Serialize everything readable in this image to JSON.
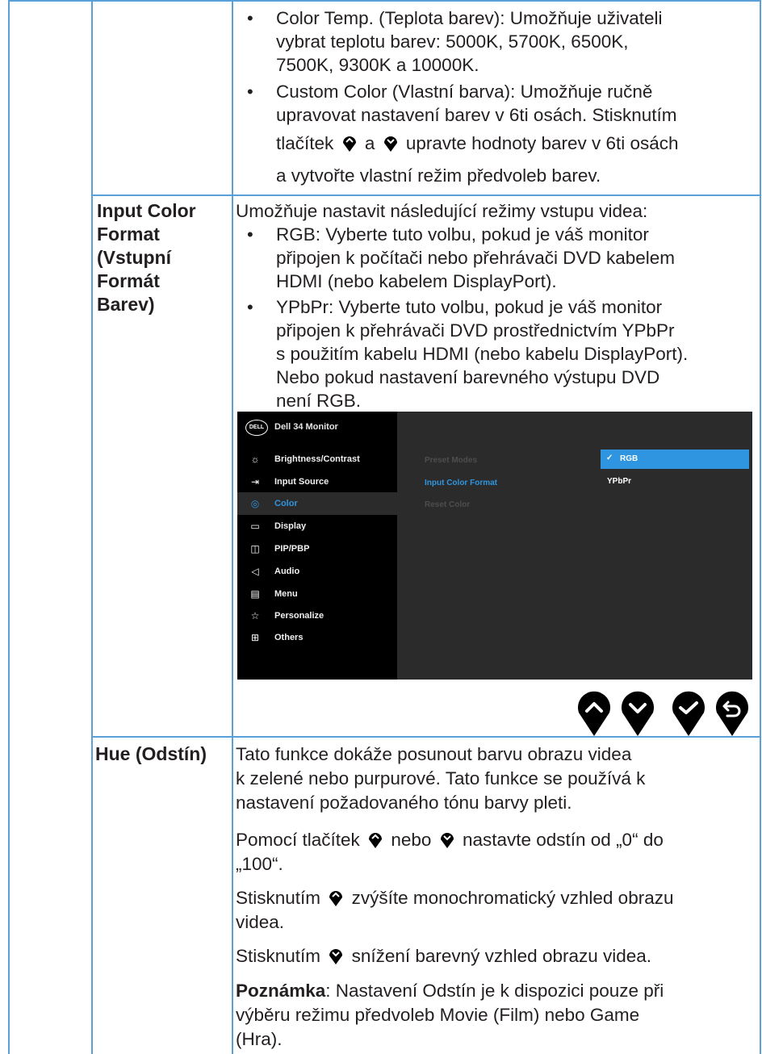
{
  "color_section": {
    "bullets": [
      {
        "lines": [
          "Color Temp. (Teplota barev): Umožňuje uživateli",
          "vybrat teplotu barev: 5000K, 5700K, 6500K,",
          "7500K, 9300K a 10000K."
        ]
      },
      {
        "lines": [
          "Custom Color (Vlastní barva): Umožňuje ručně",
          "upravovat nastavení barev v 6ti osách. Stisknutím"
        ]
      }
    ],
    "custom_line3_a": "tlačítek",
    "custom_line3_b": "a",
    "custom_line3_c": "upravte hodnoty barev v 6ti osách",
    "custom_line4": "a vytvořte vlastní režim předvoleb barev."
  },
  "input_color_format": {
    "label_lines": [
      "Input Color",
      "Format",
      "(Vstupní",
      "Formát",
      "Barev)"
    ],
    "intro": "Umožňuje nastavit následující režimy vstupu videa:",
    "rgb_lines": [
      "RGB: Vyberte tuto volbu, pokud je váš monitor",
      "připojen k počítači nebo přehrávači DVD kabelem",
      "HDMI (nebo kabelem DisplayPort)."
    ],
    "ypbpr_lines": [
      "YPbPr: Vyberte tuto volbu, pokud je váš monitor",
      "připojen k přehrávači DVD prostřednictvím YPbPr",
      "s použitím kabelu HDMI (nebo kabelu DisplayPort).",
      "Nebo pokud nastavení barevného výstupu DVD",
      "není RGB."
    ]
  },
  "osd": {
    "logo": "DELL",
    "title": "Dell 34 Monitor",
    "menu": [
      {
        "label": "Brightness/Contrast",
        "icon": "brightness-icon",
        "glyph": "☼"
      },
      {
        "label": "Input Source",
        "icon": "input-source-icon",
        "glyph": "⇥"
      },
      {
        "label": "Color",
        "icon": "color-palette-icon",
        "glyph": "◎"
      },
      {
        "label": "Display",
        "icon": "display-monitor-icon",
        "glyph": "▭"
      },
      {
        "label": "PIP/PBP",
        "icon": "pip-pbp-icon",
        "glyph": "◫"
      },
      {
        "label": "Audio",
        "icon": "audio-speaker-icon",
        "glyph": "◁"
      },
      {
        "label": "Menu",
        "icon": "menu-list-icon",
        "glyph": "▤"
      },
      {
        "label": "Personalize",
        "icon": "star-icon",
        "glyph": "☆"
      },
      {
        "label": "Others",
        "icon": "others-icon",
        "glyph": "⊞"
      }
    ],
    "submenu": [
      "Preset Modes",
      "Input Color Format",
      "Reset Color"
    ],
    "options": [
      "RGB",
      "YPbPr"
    ],
    "selected_check": "✓",
    "colors": {
      "accent": "#2f95e0",
      "panel": "#2b2b2b",
      "sidebar": "#000000"
    }
  },
  "nav_buttons": [
    {
      "name": "up-button",
      "icon": "chevron-up-icon"
    },
    {
      "name": "down-button",
      "icon": "chevron-down-icon"
    },
    {
      "name": "ok-button",
      "icon": "checkmark-icon"
    },
    {
      "name": "back-button",
      "icon": "back-arrow-icon"
    }
  ],
  "hue": {
    "label": "Hue (Odstín)",
    "p1_lines": [
      "Tato funkce dokáže posunout barvu obrazu videa",
      "k zelené nebo purpurové. Tato funkce se používá k",
      "nastavení požadovaného tónu barvy pleti."
    ],
    "p2_a": "Pomocí tlačítek",
    "p2_b": "nebo",
    "p2_c": "nastavte odstín od „0“ do",
    "p2_line2": "„100“.",
    "p3_a": "Stisknutím",
    "p3_b": "zvýšíte monochromatický vzhled obrazu",
    "p3_line2": "videa.",
    "p4_a": "Stisknutím",
    "p4_b": "snížení barevný vzhled obrazu videa.",
    "note_bold": "Poznámka",
    "note_lines": [
      ": Nastavení Odstín je k dispozici pouze při",
      "výběru režimu předvoleb Movie (Film) nebo Game",
      "(Hra)."
    ]
  }
}
